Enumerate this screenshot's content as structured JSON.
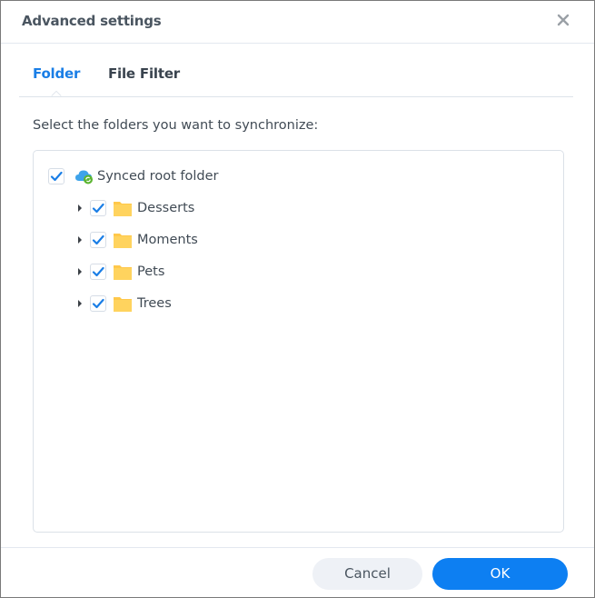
{
  "dialog": {
    "title": "Advanced settings",
    "close_icon": "close-icon"
  },
  "tabs": [
    {
      "label": "Folder",
      "active": true
    },
    {
      "label": "File Filter",
      "active": false
    }
  ],
  "instruction": "Select the folders you want to synchronize:",
  "tree": {
    "root": {
      "label": "Synced root folder",
      "checked": true,
      "icon": "synced-cloud-icon"
    },
    "children": [
      {
        "label": "Desserts",
        "checked": true,
        "icon": "folder-icon",
        "expandable": true
      },
      {
        "label": "Moments",
        "checked": true,
        "icon": "folder-icon",
        "expandable": true
      },
      {
        "label": "Pets",
        "checked": true,
        "icon": "folder-icon",
        "expandable": true
      },
      {
        "label": "Trees",
        "checked": true,
        "icon": "folder-icon",
        "expandable": true
      }
    ]
  },
  "footer": {
    "cancel_label": "Cancel",
    "ok_label": "OK"
  },
  "colors": {
    "accent": "#0d7ff2",
    "tab_active": "#1a7ee6",
    "folder": "#ffc84a"
  }
}
